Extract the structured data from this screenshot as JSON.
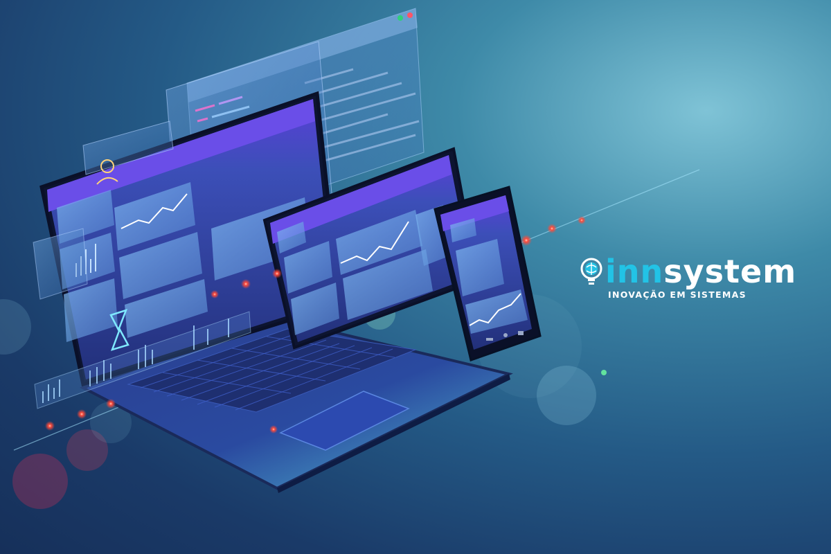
{
  "brand": {
    "name_part1": "inn",
    "name_part2": "system",
    "tagline": "INOVAÇÃO EM SISTEMAS"
  },
  "illustration": {
    "devices": [
      "laptop",
      "tablet",
      "smartphone",
      "browser-window"
    ],
    "icons": [
      "user-icon",
      "hourglass-icon",
      "line-chart-icon",
      "bar-chart-icon",
      "globe-icon",
      "lightbulb-icon"
    ]
  },
  "colors": {
    "background_dark": "#16305a",
    "background_light": "#7fc3d6",
    "brand_cyan": "#22c3e6",
    "accent_purple": "#7a5bf0",
    "accent_red": "#ff4a3a"
  }
}
